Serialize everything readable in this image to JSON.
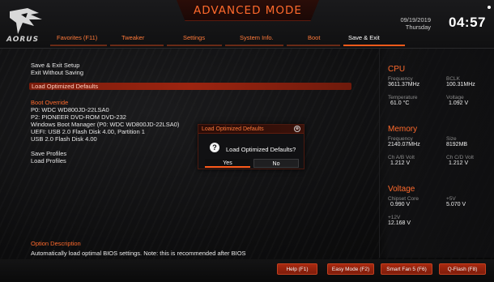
{
  "header": {
    "title": "ADVANCED MODE",
    "logo_text": "AORUS",
    "date": "09/19/2019",
    "day": "Thursday",
    "time": "04:57",
    "tabs": [
      {
        "label": "Favorites (F11)",
        "active": false
      },
      {
        "label": "Tweaker",
        "active": false
      },
      {
        "label": "Settings",
        "active": false
      },
      {
        "label": "System Info.",
        "active": false
      },
      {
        "label": "Boot",
        "active": false
      },
      {
        "label": "Save & Exit",
        "active": true
      }
    ]
  },
  "menu": {
    "save_exit_setup": "Save & Exit Setup",
    "exit_without_saving": "Exit Without Saving",
    "load_optimized_defaults": "Load Optimized Defaults",
    "boot_override": "Boot Override",
    "boot_items": [
      "P0: WDC WD800JD-22LSA0",
      "P2: PIONEER DVD-ROM DVD-232",
      "Windows Boot Manager (P0: WDC WD800JD-22LSA0)",
      "UEFI: USB 2.0 Flash Disk 4.00, Partition 1",
      "USB 2.0 Flash Disk 4.00"
    ],
    "save_profiles": "Save Profiles",
    "load_profiles": "Load Profiles"
  },
  "dialog": {
    "title": "Load Optimized Defaults",
    "message": "Load Optimized Defaults?",
    "yes": "Yes",
    "no": "No",
    "question_glyph": "?",
    "close_glyph": "⊗"
  },
  "right_panel": {
    "cpu": {
      "title": "CPU",
      "frequency_label": "Frequency",
      "frequency_value": "3611.37MHz",
      "bclk_label": "BCLK",
      "bclk_value": "100.31MHz",
      "temperature_label": "Temperature",
      "temperature_value": "61.0 °C",
      "voltage_label": "Voltage",
      "voltage_value": "1.092 V"
    },
    "memory": {
      "title": "Memory",
      "frequency_label": "Frequency",
      "frequency_value": "2140.07MHz",
      "size_label": "Size",
      "size_value": "8192MB",
      "chab_label": "Ch A/B Volt",
      "chab_value": "1.212 V",
      "chcd_label": "Ch C/D Volt",
      "chcd_value": "1.212 V"
    },
    "voltage": {
      "title": "Voltage",
      "chipset_label": "Chipset Core",
      "chipset_value": "0.990 V",
      "p5v_label": "+5V",
      "p5v_value": "5.070 V",
      "p12v_label": "+12V",
      "p12v_value": "12.168 V"
    }
  },
  "option_description": {
    "title": "Option Description",
    "text": "Automatically load optimal BIOS settings. Note: this is recommended after BIOS"
  },
  "footer": {
    "help": "Help (F1)",
    "easy_mode": "Easy Mode (F2)",
    "smart_fan": "Smart Fan 5 (F6)",
    "qflash": "Q-Flash (F8)"
  },
  "colors": {
    "accent": "#ff6a2c",
    "highlight": "#9c2410",
    "background": "#0d0d0e"
  }
}
